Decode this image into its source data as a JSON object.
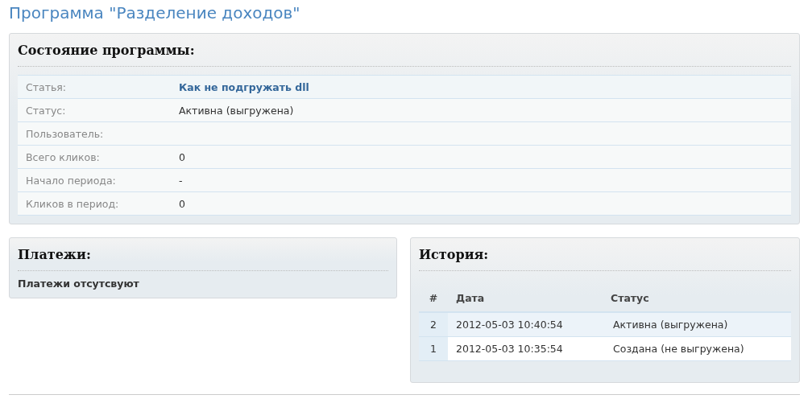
{
  "page_title": "Программа \"Разделение доходов\"",
  "status_panel": {
    "heading": "Состояние программы:",
    "rows": [
      {
        "label": "Статья:",
        "value": "Как не подгружать dll",
        "kind": "link"
      },
      {
        "label": "Статус:",
        "value": "Активна (выгружена)",
        "kind": "text"
      },
      {
        "label": "Пользователь:"
      },
      {
        "label": "Всего кликов:",
        "value": "0",
        "kind": "text"
      },
      {
        "label": "Начало периода:",
        "value": "-",
        "kind": "text"
      },
      {
        "label": "Кликов в период:",
        "value": "0",
        "kind": "text"
      }
    ]
  },
  "payments_panel": {
    "heading": "Платежи:",
    "message": "Платежи отсутсвуют"
  },
  "history_panel": {
    "heading": "История:",
    "columns": [
      "#",
      "Дата",
      "Статус"
    ],
    "rows": [
      [
        "2",
        "2012-05-03 10:40:54",
        "Активна (выгружена)"
      ],
      [
        "1",
        "2012-05-03 10:35:54",
        "Создана (не выгружена)"
      ]
    ]
  }
}
